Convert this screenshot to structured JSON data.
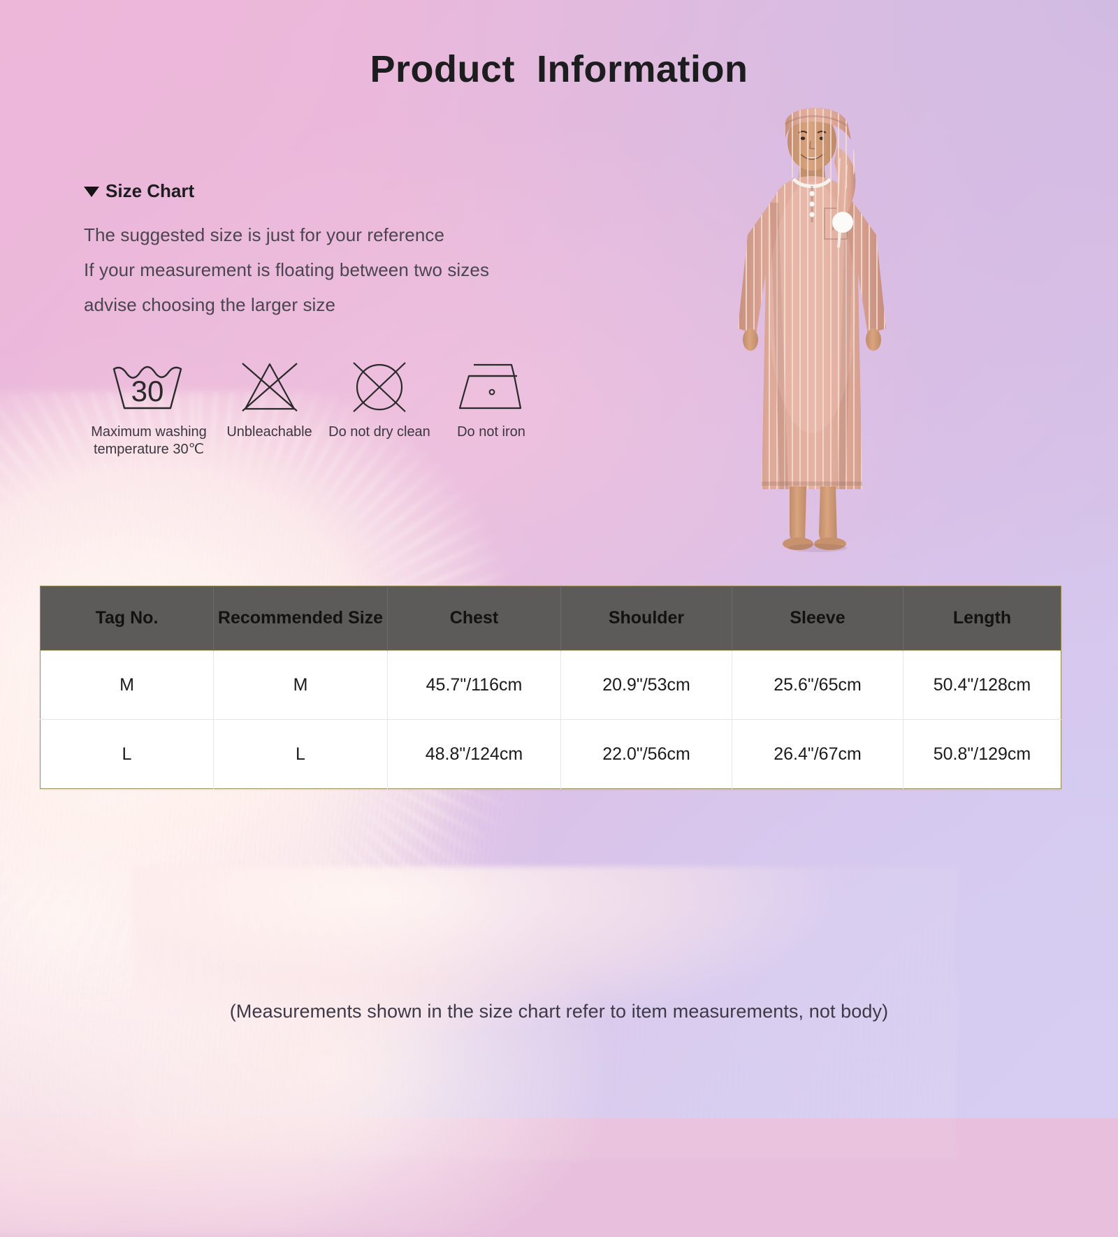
{
  "header": {
    "title": "Product  Information"
  },
  "size_chart": {
    "heading": "Size Chart",
    "marker_icon": "triangle-down-icon",
    "notes": [
      "The suggested size is just for your reference",
      "If your measurement is floating between two sizes",
      "advise choosing the larger size"
    ]
  },
  "care_instructions": [
    {
      "icon": "wash-tub-30-icon",
      "label": "Maximum washing\ntemperature 30℃",
      "temperature": "30"
    },
    {
      "icon": "do-not-bleach-icon",
      "label": "Unbleachable"
    },
    {
      "icon": "do-not-dry-clean-icon",
      "label": "Do not dry clean"
    },
    {
      "icon": "do-not-iron-icon",
      "label": "Do not iron"
    }
  ],
  "model_photo": {
    "alt": "Man wearing pink striped long thobe nightgown with matching head wrap"
  },
  "table": {
    "columns": [
      "Tag No.",
      "Recommended Size",
      "Chest",
      "Shoulder",
      "Sleeve",
      "Length"
    ],
    "rows": [
      {
        "tag_no": "M",
        "recommended_size": "M",
        "chest": "45.7\"/116cm",
        "shoulder": "20.9\"/53cm",
        "sleeve": "25.6\"/65cm",
        "length": "50.4\"/128cm"
      },
      {
        "tag_no": "L",
        "recommended_size": "L",
        "chest": "48.8\"/124cm",
        "shoulder": "22.0\"/56cm",
        "sleeve": "26.4\"/67cm",
        "length": "50.8\"/129cm"
      }
    ]
  },
  "footnote": "(Measurements shown in the size chart refer to item measurements, not body)",
  "colors": {
    "background_pink": "#eab6da",
    "background_lavender": "#d5cbef",
    "table_header_bg": "#5d5b59",
    "table_border": "#9a8f59",
    "text_dark": "#1d1d1f",
    "text_body": "#4b4550",
    "garment_pink": "#d9a193"
  }
}
